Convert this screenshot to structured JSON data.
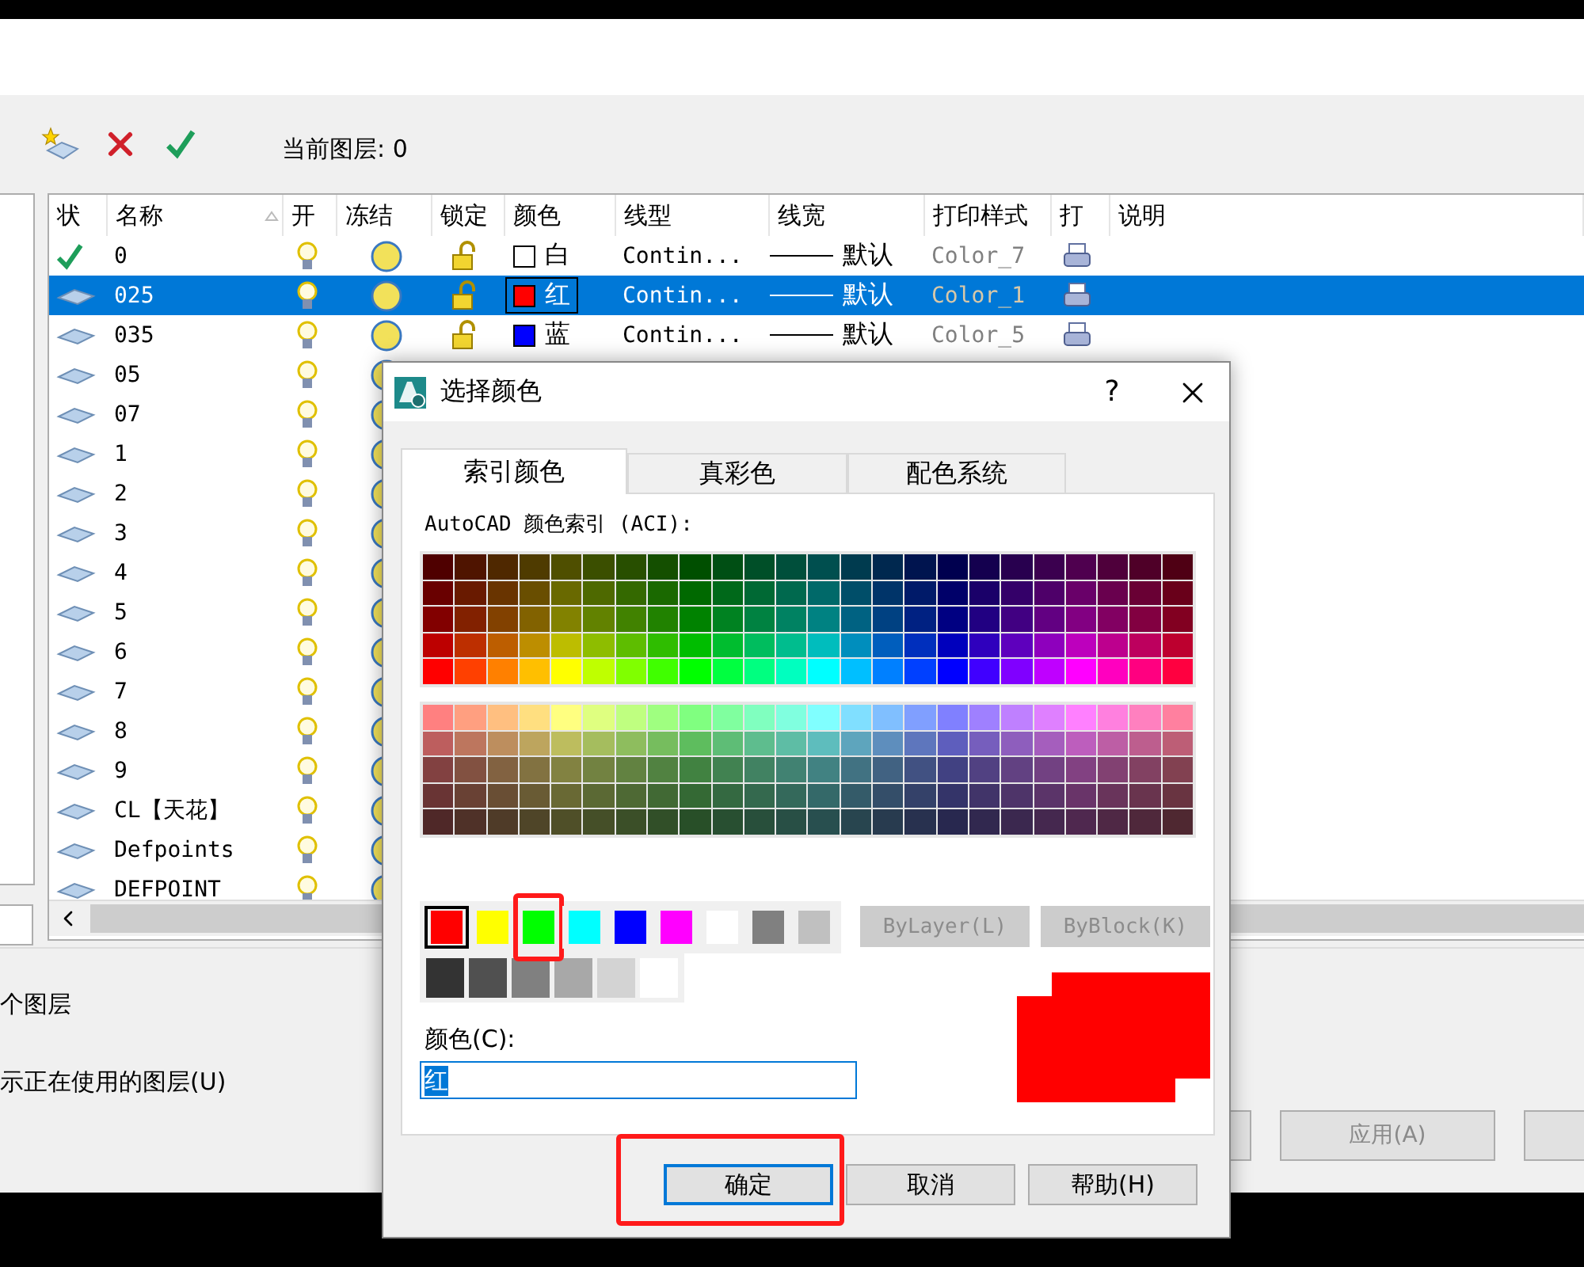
{
  "toolbar": {
    "current_layer_label": "当前图层: 0"
  },
  "layer_table": {
    "columns": [
      "状",
      "名称",
      "开",
      "冻结",
      "锁定",
      "颜色",
      "线型",
      "线宽",
      "打印样式",
      "打",
      "说明"
    ],
    "rows": [
      {
        "kind": "current",
        "name": "0",
        "on": true,
        "frozen": false,
        "locked": false,
        "color_name": "白",
        "color": "#ffffff",
        "linetype": "Contin...",
        "lineweight": "默认",
        "plot_style": "Color_7",
        "selected": false
      },
      {
        "kind": "layer",
        "name": "025",
        "on": true,
        "frozen": false,
        "locked": false,
        "color_name": "红",
        "color": "#ff0000",
        "linetype": "Contin...",
        "lineweight": "默认",
        "plot_style": "Color_1",
        "selected": true
      },
      {
        "kind": "layer",
        "name": "035",
        "on": true,
        "frozen": false,
        "locked": false,
        "color_name": "蓝",
        "color": "#0000ff",
        "linetype": "Contin...",
        "lineweight": "默认",
        "plot_style": "Color_5",
        "selected": false
      },
      {
        "kind": "layer",
        "name": "05",
        "on": true,
        "frozen": false,
        "selected": false
      },
      {
        "kind": "layer",
        "name": "07",
        "on": true,
        "frozen": false,
        "selected": false
      },
      {
        "kind": "layer",
        "name": "1",
        "on": true,
        "frozen": false,
        "selected": false
      },
      {
        "kind": "layer",
        "name": "2",
        "on": true,
        "frozen": false,
        "selected": false
      },
      {
        "kind": "layer",
        "name": "3",
        "on": true,
        "frozen": false,
        "selected": false
      },
      {
        "kind": "layer",
        "name": "4",
        "on": true,
        "frozen": false,
        "selected": false
      },
      {
        "kind": "layer",
        "name": "5",
        "on": true,
        "frozen": false,
        "selected": false
      },
      {
        "kind": "layer",
        "name": "6",
        "on": true,
        "frozen": false,
        "selected": false
      },
      {
        "kind": "layer",
        "name": "7",
        "on": true,
        "frozen": false,
        "selected": false
      },
      {
        "kind": "layer",
        "name": "8",
        "on": true,
        "frozen": false,
        "selected": false
      },
      {
        "kind": "layer",
        "name": "9",
        "on": true,
        "frozen": false,
        "selected": false
      },
      {
        "kind": "layer",
        "name": "CL【天花】",
        "on": true,
        "frozen": false,
        "selected": false
      },
      {
        "kind": "layer",
        "name": "Defpoints",
        "on": true,
        "frozen": false,
        "selected": false
      },
      {
        "kind": "layer",
        "name": "DEFPOINT",
        "on": true,
        "frozen": false,
        "selected": false
      }
    ]
  },
  "bottom": {
    "count_text": "个图层",
    "show_used_label": "示正在使用的图层(U)",
    "apply_button": {
      "label": "应用(A)",
      "disabled": true
    }
  },
  "color_dialog": {
    "title": "选择颜色",
    "help": "?",
    "tabs": [
      {
        "label": "索引颜色",
        "selected": true
      },
      {
        "label": "真彩色",
        "selected": false
      },
      {
        "label": "配色系统",
        "selected": false
      }
    ],
    "aci_label": "AutoCAD 颜色索引 (ACI):",
    "standard_colors": [
      {
        "color": "#ff0000",
        "selected": true
      },
      {
        "color": "#ffff00",
        "selected": false
      },
      {
        "color": "#00ff00",
        "selected": false,
        "highlighted": true
      },
      {
        "color": "#00ffff",
        "selected": false
      },
      {
        "color": "#0000ff",
        "selected": false
      },
      {
        "color": "#ff00ff",
        "selected": false
      },
      {
        "color": "#ffffff",
        "selected": false
      },
      {
        "color": "#808080",
        "selected": false
      },
      {
        "color": "#c0c0c0",
        "selected": false
      }
    ],
    "gray_colors": [
      {
        "color": "#333333"
      },
      {
        "color": "#505050"
      },
      {
        "color": "#808080"
      },
      {
        "color": "#a8a8a8"
      },
      {
        "color": "#d3d3d3"
      },
      {
        "color": "#ffffff"
      }
    ],
    "special_buttons": [
      {
        "label": "ByLayer(L)",
        "disabled": true
      },
      {
        "label": "ByBlock(K)",
        "disabled": true
      }
    ],
    "color_field": {
      "label": "颜色(C):",
      "value": "红"
    },
    "buttons": [
      {
        "label": "确定",
        "default": true,
        "highlighted": true
      },
      {
        "label": "取消",
        "default": false
      },
      {
        "label": "帮助(H)",
        "default": false
      }
    ]
  }
}
